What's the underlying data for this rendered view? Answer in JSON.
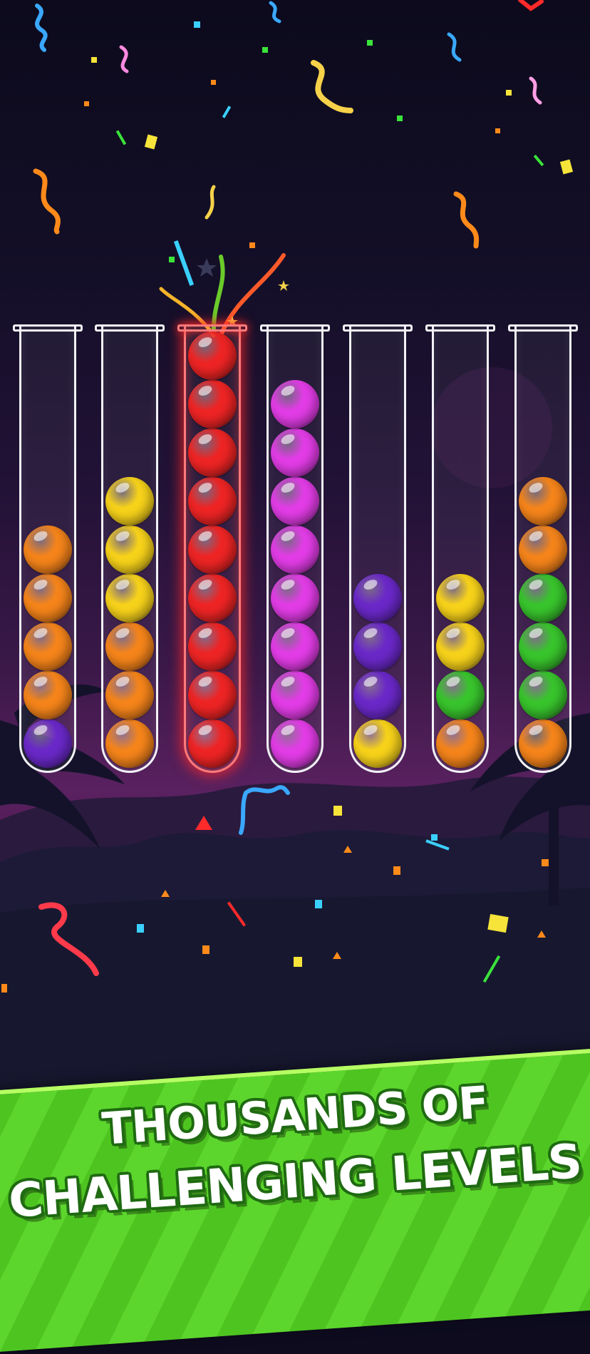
{
  "promo": {
    "headline_line1": "THOUSANDS OF",
    "headline_line2": "CHALLENGING LEVELS"
  },
  "colors": {
    "orange": "#f5841a",
    "purple": "#6a28c8",
    "yellow": "#f7d21a",
    "red": "#ee2424",
    "magenta": "#e23ce6",
    "green": "#38c42c",
    "banner_green": "#56d126"
  },
  "game": {
    "selected_tube": 3,
    "tubes": [
      {
        "id": 1,
        "balls_bottom_to_top": [
          "purple",
          "orange",
          "orange",
          "orange",
          "orange"
        ]
      },
      {
        "id": 2,
        "balls_bottom_to_top": [
          "orange",
          "orange",
          "orange",
          "yellow",
          "yellow",
          "yellow"
        ]
      },
      {
        "id": 3,
        "balls_bottom_to_top": [
          "red",
          "red",
          "red",
          "red",
          "red",
          "red",
          "red",
          "red",
          "red"
        ]
      },
      {
        "id": 4,
        "balls_bottom_to_top": [
          "magenta",
          "magenta",
          "magenta",
          "magenta",
          "magenta",
          "magenta",
          "magenta",
          "magenta"
        ]
      },
      {
        "id": 5,
        "balls_bottom_to_top": [
          "yellow",
          "purple",
          "purple",
          "purple"
        ]
      },
      {
        "id": 6,
        "balls_bottom_to_top": [
          "orange",
          "green",
          "yellow",
          "yellow"
        ]
      },
      {
        "id": 7,
        "balls_bottom_to_top": [
          "orange",
          "green",
          "green",
          "green",
          "orange",
          "orange"
        ]
      }
    ]
  }
}
